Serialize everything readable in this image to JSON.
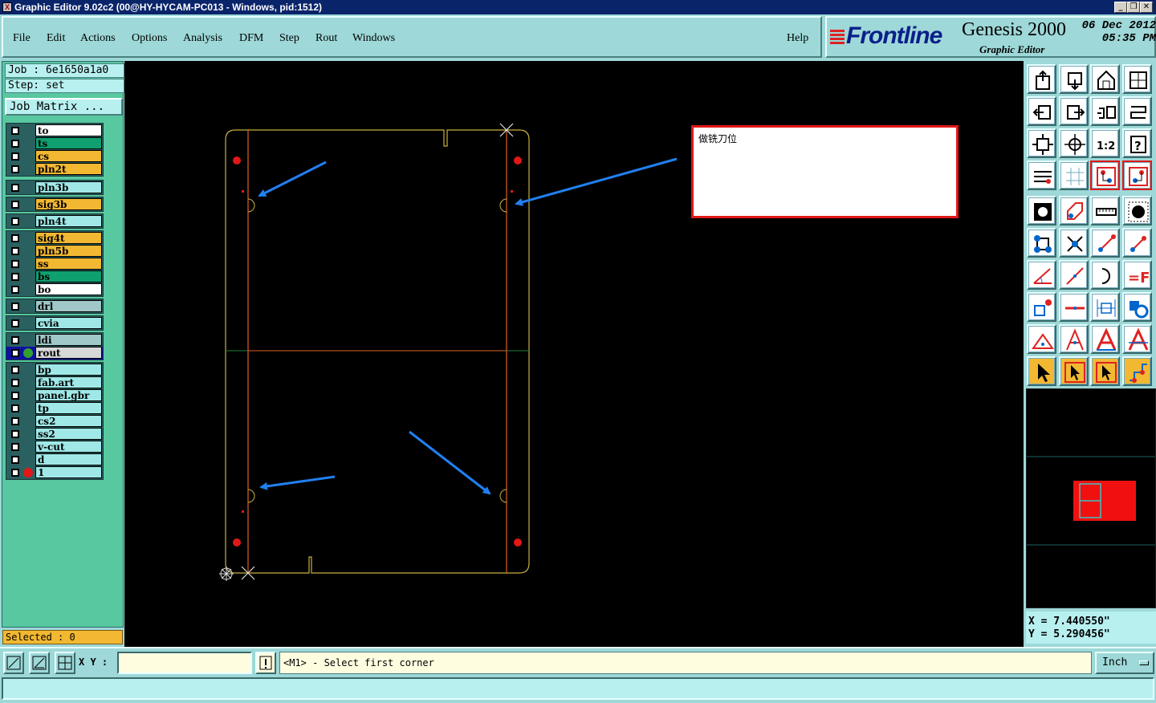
{
  "window": {
    "title": "Graphic Editor 9.02c2 (00@HY-HYCAM-PC013 - Windows, pid:1512)",
    "minimize": "_",
    "restore": "❐",
    "close": "✕"
  },
  "menu": [
    "File",
    "Edit",
    "Actions",
    "Options",
    "Analysis",
    "DFM",
    "Step",
    "Rout",
    "Windows"
  ],
  "help": "Help",
  "brand": {
    "logo": "Frontline",
    "product": "Genesis 2000",
    "subtitle": "Graphic Editor",
    "date": "06 Dec 2012",
    "time": "05:35 PM"
  },
  "job": "Job  : 6e1650a1a0",
  "step": "Step:  set",
  "job_matrix": "Job Matrix ...",
  "layers": [
    {
      "name": "to",
      "color": "#ffffff"
    },
    {
      "name": "ts",
      "color": "#10a070"
    },
    {
      "name": "cs",
      "color": "#f2b832"
    },
    {
      "name": "pln2t",
      "color": "#f2b832"
    },
    {
      "name": "pln3b",
      "color": "#a0e8e8"
    },
    {
      "name": "sig3b",
      "color": "#f2b832"
    },
    {
      "name": "pln4t",
      "color": "#a0e8e8"
    },
    {
      "name": "sig4t",
      "color": "#f2b832"
    },
    {
      "name": "pln5b",
      "color": "#f2b832"
    },
    {
      "name": "ss",
      "color": "#f2b832"
    },
    {
      "name": "bs",
      "color": "#10a070"
    },
    {
      "name": "bo",
      "color": "#ffffff"
    },
    {
      "name": "drl",
      "color": "#a0c8c8"
    },
    {
      "name": "cvia",
      "color": "#a0e8e8"
    },
    {
      "name": "ldi",
      "color": "#a0c8c8"
    },
    {
      "name": "rout",
      "color": "#d8d8d8"
    },
    {
      "name": "bp",
      "color": "#a0e8e8"
    },
    {
      "name": "fab.art",
      "color": "#a0e8e8"
    },
    {
      "name": "panel.gbr",
      "color": "#a0e8e8"
    },
    {
      "name": "tp",
      "color": "#a0e8e8"
    },
    {
      "name": "cs2",
      "color": "#a0e8e8"
    },
    {
      "name": "ss2",
      "color": "#a0e8e8"
    },
    {
      "name": "v-cut",
      "color": "#a0e8e8"
    },
    {
      "name": "d",
      "color": "#a0e8e8"
    },
    {
      "name": "1",
      "color": "#a0e8e8"
    }
  ],
  "selected": "Selected : 0",
  "note_text": "做铣刀位",
  "coords": {
    "x": "X = 7.440550\"",
    "y": "Y = 5.290456\""
  },
  "xy_label": "X Y :",
  "xy_value": "",
  "prompt_message": "<M1> - Select first corner",
  "unit": "Inch",
  "colors": {
    "panel": "#9ed8d8",
    "canvas": "#000000",
    "outline": "#c8b040",
    "rout": "#e06020",
    "arrow": "#2080f0",
    "pad": "#e01818"
  },
  "tool_icons": [
    "zoom-home-icon",
    "zoom-in-icon",
    "home-icon",
    "window-icon",
    "pan-left-icon",
    "pan-right-icon",
    "undo-icon",
    "redraw-icon",
    "fit-icon",
    "center-icon",
    "scale-1to2-icon",
    "help-icon",
    "settings-icon",
    "grid-icon",
    "layers-compare-icon",
    "layers-toggle-icon",
    "pad-icon",
    "outline-icon",
    "ruler-icon",
    "dot-icon",
    "snap-node-icon",
    "snap-intersect-icon",
    "snap-end-icon",
    "snap-mid-icon",
    "angle-icon",
    "line-icon",
    "arc-icon",
    "text-icon",
    "point-icon",
    "horizontal-icon",
    "measure-icon",
    "shape-icon",
    "triangle-icon",
    "letter-a-icon",
    "letter-a-bold-icon",
    "letter-a-arc-icon",
    "pointer-icon",
    "select-icon",
    "select-rotate-icon",
    "route-icon"
  ]
}
